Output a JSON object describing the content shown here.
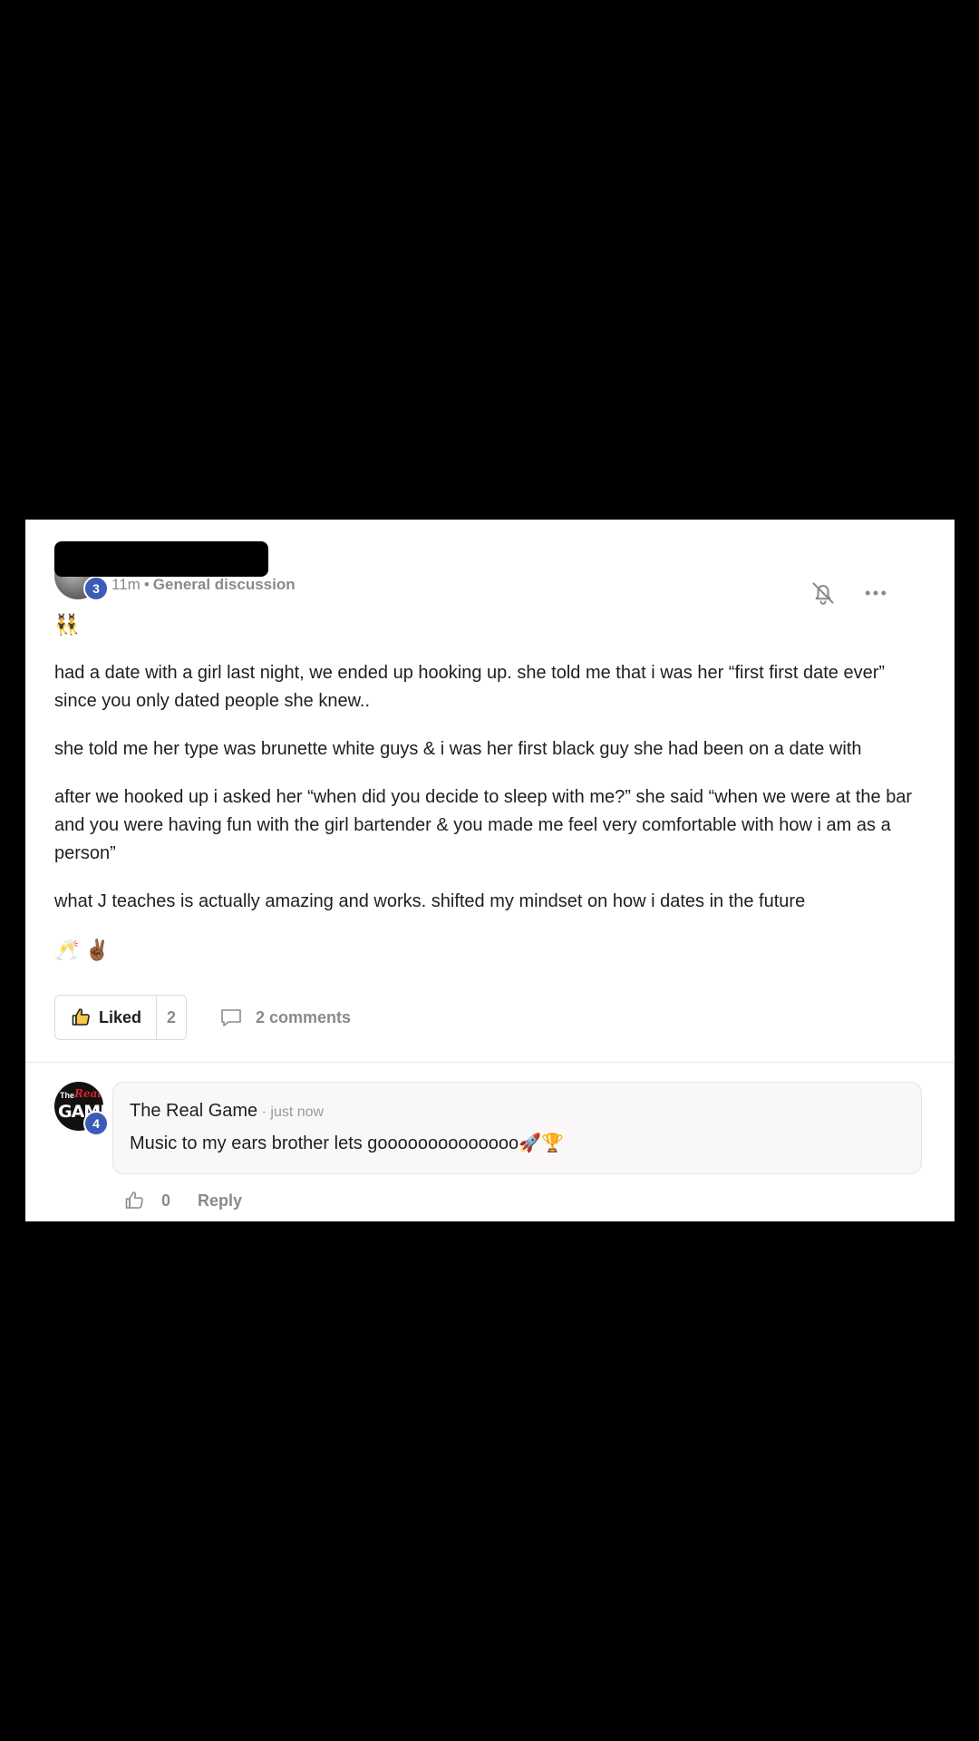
{
  "post": {
    "author_level": "3",
    "time": "11m",
    "separator": "•",
    "category": "General discussion",
    "emoji_top": "👯‍♂️",
    "paragraphs": [
      "had a date with a girl last night, we ended up hooking up. she told me that i was her “first first date ever” since you only dated people she knew..",
      "she told me her type was brunette white guys & i was her first black guy she had been on a date with",
      "after we hooked up i asked her “when did you decide to sleep with me?” she said “when we were at the bar and you were having fun with the girl bartender & you made me feel very comfortable with how i am as a person”",
      "what J teaches is actually amazing and works. shifted my mindset on how i dates in the future"
    ],
    "emoji_bottom": "🥂 ✌🏾",
    "liked_label": "Liked",
    "like_count": "2",
    "comments_label": "2 comments"
  },
  "comment": {
    "author": "The Real Game",
    "author_level": "4",
    "time": "· just now",
    "text": "Music to my ears brother lets goooooooooooooo🚀🏆",
    "like_count": "0",
    "reply_label": "Reply",
    "avatar_logo": {
      "the": "The",
      "real": "Real",
      "game": "GAME"
    }
  },
  "colors": {
    "background": "#000000",
    "card": "#ffffff",
    "badge": "#3c5bb8",
    "muted_text": "#8a8a8a",
    "liked_thumb_fill": "#f7c948"
  },
  "icons": {
    "notify": "bell-off-icon",
    "more": "more-horizontal-icon",
    "like": "thumbs-up-icon",
    "comments": "chat-bubble-icon",
    "comment_like": "thumbs-up-outline-icon"
  }
}
